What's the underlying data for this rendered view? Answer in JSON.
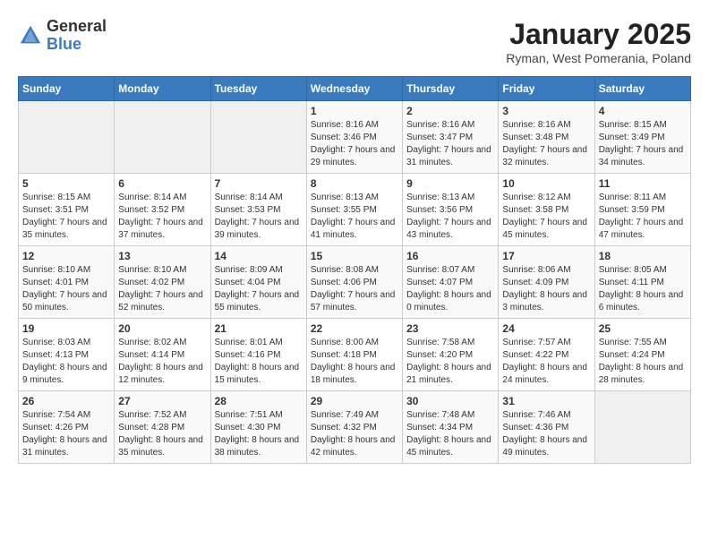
{
  "header": {
    "logo_general": "General",
    "logo_blue": "Blue",
    "month_title": "January 2025",
    "location": "Ryman, West Pomerania, Poland"
  },
  "weekdays": [
    "Sunday",
    "Monday",
    "Tuesday",
    "Wednesday",
    "Thursday",
    "Friday",
    "Saturday"
  ],
  "weeks": [
    [
      {
        "day": "",
        "content": ""
      },
      {
        "day": "",
        "content": ""
      },
      {
        "day": "",
        "content": ""
      },
      {
        "day": "1",
        "content": "Sunrise: 8:16 AM\nSunset: 3:46 PM\nDaylight: 7 hours and 29 minutes."
      },
      {
        "day": "2",
        "content": "Sunrise: 8:16 AM\nSunset: 3:47 PM\nDaylight: 7 hours and 31 minutes."
      },
      {
        "day": "3",
        "content": "Sunrise: 8:16 AM\nSunset: 3:48 PM\nDaylight: 7 hours and 32 minutes."
      },
      {
        "day": "4",
        "content": "Sunrise: 8:15 AM\nSunset: 3:49 PM\nDaylight: 7 hours and 34 minutes."
      }
    ],
    [
      {
        "day": "5",
        "content": "Sunrise: 8:15 AM\nSunset: 3:51 PM\nDaylight: 7 hours and 35 minutes."
      },
      {
        "day": "6",
        "content": "Sunrise: 8:14 AM\nSunset: 3:52 PM\nDaylight: 7 hours and 37 minutes."
      },
      {
        "day": "7",
        "content": "Sunrise: 8:14 AM\nSunset: 3:53 PM\nDaylight: 7 hours and 39 minutes."
      },
      {
        "day": "8",
        "content": "Sunrise: 8:13 AM\nSunset: 3:55 PM\nDaylight: 7 hours and 41 minutes."
      },
      {
        "day": "9",
        "content": "Sunrise: 8:13 AM\nSunset: 3:56 PM\nDaylight: 7 hours and 43 minutes."
      },
      {
        "day": "10",
        "content": "Sunrise: 8:12 AM\nSunset: 3:58 PM\nDaylight: 7 hours and 45 minutes."
      },
      {
        "day": "11",
        "content": "Sunrise: 8:11 AM\nSunset: 3:59 PM\nDaylight: 7 hours and 47 minutes."
      }
    ],
    [
      {
        "day": "12",
        "content": "Sunrise: 8:10 AM\nSunset: 4:01 PM\nDaylight: 7 hours and 50 minutes."
      },
      {
        "day": "13",
        "content": "Sunrise: 8:10 AM\nSunset: 4:02 PM\nDaylight: 7 hours and 52 minutes."
      },
      {
        "day": "14",
        "content": "Sunrise: 8:09 AM\nSunset: 4:04 PM\nDaylight: 7 hours and 55 minutes."
      },
      {
        "day": "15",
        "content": "Sunrise: 8:08 AM\nSunset: 4:06 PM\nDaylight: 7 hours and 57 minutes."
      },
      {
        "day": "16",
        "content": "Sunrise: 8:07 AM\nSunset: 4:07 PM\nDaylight: 8 hours and 0 minutes."
      },
      {
        "day": "17",
        "content": "Sunrise: 8:06 AM\nSunset: 4:09 PM\nDaylight: 8 hours and 3 minutes."
      },
      {
        "day": "18",
        "content": "Sunrise: 8:05 AM\nSunset: 4:11 PM\nDaylight: 8 hours and 6 minutes."
      }
    ],
    [
      {
        "day": "19",
        "content": "Sunrise: 8:03 AM\nSunset: 4:13 PM\nDaylight: 8 hours and 9 minutes."
      },
      {
        "day": "20",
        "content": "Sunrise: 8:02 AM\nSunset: 4:14 PM\nDaylight: 8 hours and 12 minutes."
      },
      {
        "day": "21",
        "content": "Sunrise: 8:01 AM\nSunset: 4:16 PM\nDaylight: 8 hours and 15 minutes."
      },
      {
        "day": "22",
        "content": "Sunrise: 8:00 AM\nSunset: 4:18 PM\nDaylight: 8 hours and 18 minutes."
      },
      {
        "day": "23",
        "content": "Sunrise: 7:58 AM\nSunset: 4:20 PM\nDaylight: 8 hours and 21 minutes."
      },
      {
        "day": "24",
        "content": "Sunrise: 7:57 AM\nSunset: 4:22 PM\nDaylight: 8 hours and 24 minutes."
      },
      {
        "day": "25",
        "content": "Sunrise: 7:55 AM\nSunset: 4:24 PM\nDaylight: 8 hours and 28 minutes."
      }
    ],
    [
      {
        "day": "26",
        "content": "Sunrise: 7:54 AM\nSunset: 4:26 PM\nDaylight: 8 hours and 31 minutes."
      },
      {
        "day": "27",
        "content": "Sunrise: 7:52 AM\nSunset: 4:28 PM\nDaylight: 8 hours and 35 minutes."
      },
      {
        "day": "28",
        "content": "Sunrise: 7:51 AM\nSunset: 4:30 PM\nDaylight: 8 hours and 38 minutes."
      },
      {
        "day": "29",
        "content": "Sunrise: 7:49 AM\nSunset: 4:32 PM\nDaylight: 8 hours and 42 minutes."
      },
      {
        "day": "30",
        "content": "Sunrise: 7:48 AM\nSunset: 4:34 PM\nDaylight: 8 hours and 45 minutes."
      },
      {
        "day": "31",
        "content": "Sunrise: 7:46 AM\nSunset: 4:36 PM\nDaylight: 8 hours and 49 minutes."
      },
      {
        "day": "",
        "content": ""
      }
    ]
  ]
}
